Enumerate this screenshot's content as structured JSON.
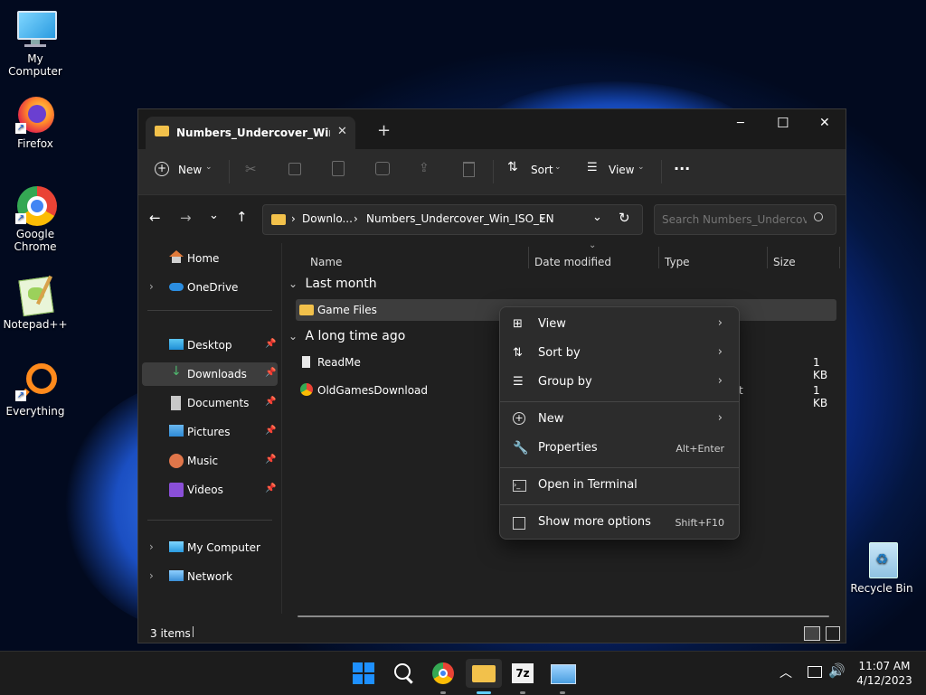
{
  "desktop": {
    "icons": [
      {
        "label": "My Computer"
      },
      {
        "label": "Firefox"
      },
      {
        "label": "Google Chrome"
      },
      {
        "label": "Notepad++"
      },
      {
        "label": "Everything"
      },
      {
        "label": "Recycle Bin"
      }
    ]
  },
  "window": {
    "tab_title": "Numbers_Undercover_Win_ISO_EN",
    "new_tab_icon": "+",
    "controls": {
      "minimize": "─",
      "maximize": "☐",
      "close": "✕"
    },
    "toolbar": {
      "new_label": "New",
      "sort_label": "Sort",
      "view_label": "View",
      "more": "···"
    },
    "address": {
      "crumbs": [
        "Downlo...",
        "Numbers_Undercover_Win_ISO_EN"
      ],
      "search_placeholder": "Search Numbers_Undercov..."
    },
    "sidebar": {
      "items": [
        {
          "label": "Home"
        },
        {
          "label": "OneDrive"
        },
        {
          "label": "Desktop"
        },
        {
          "label": "Downloads"
        },
        {
          "label": "Documents"
        },
        {
          "label": "Pictures"
        },
        {
          "label": "Music"
        },
        {
          "label": "Videos"
        },
        {
          "label": "My Computer"
        },
        {
          "label": "Network"
        }
      ]
    },
    "columns": {
      "name": "Name",
      "date": "Date modified",
      "type": "Type",
      "size": "Size"
    },
    "groups": {
      "last_month": "Last month",
      "long_ago": "A long time ago"
    },
    "files": [
      {
        "name": "Game Files",
        "size": ""
      },
      {
        "name": "ReadMe",
        "size": "1 KB"
      },
      {
        "name": "OldGamesDownload",
        "size": "1 KB",
        "type_fragment": "t"
      }
    ],
    "status": {
      "items": "3 items"
    }
  },
  "context_menu": {
    "items": [
      {
        "label": "View",
        "shortcut": ""
      },
      {
        "label": "Sort by",
        "shortcut": ""
      },
      {
        "label": "Group by",
        "shortcut": ""
      },
      {
        "label": "New",
        "shortcut": ""
      },
      {
        "label": "Properties",
        "shortcut": "Alt+Enter"
      },
      {
        "label": "Open in Terminal",
        "shortcut": ""
      },
      {
        "label": "Show more options",
        "shortcut": "Shift+F10"
      }
    ]
  },
  "taskbar": {
    "time": "11:07 AM",
    "date": "4/12/2023"
  },
  "colors": {
    "accent": "#60cdff",
    "folder": "#f2c14b",
    "selection": "#3d3d3d"
  }
}
